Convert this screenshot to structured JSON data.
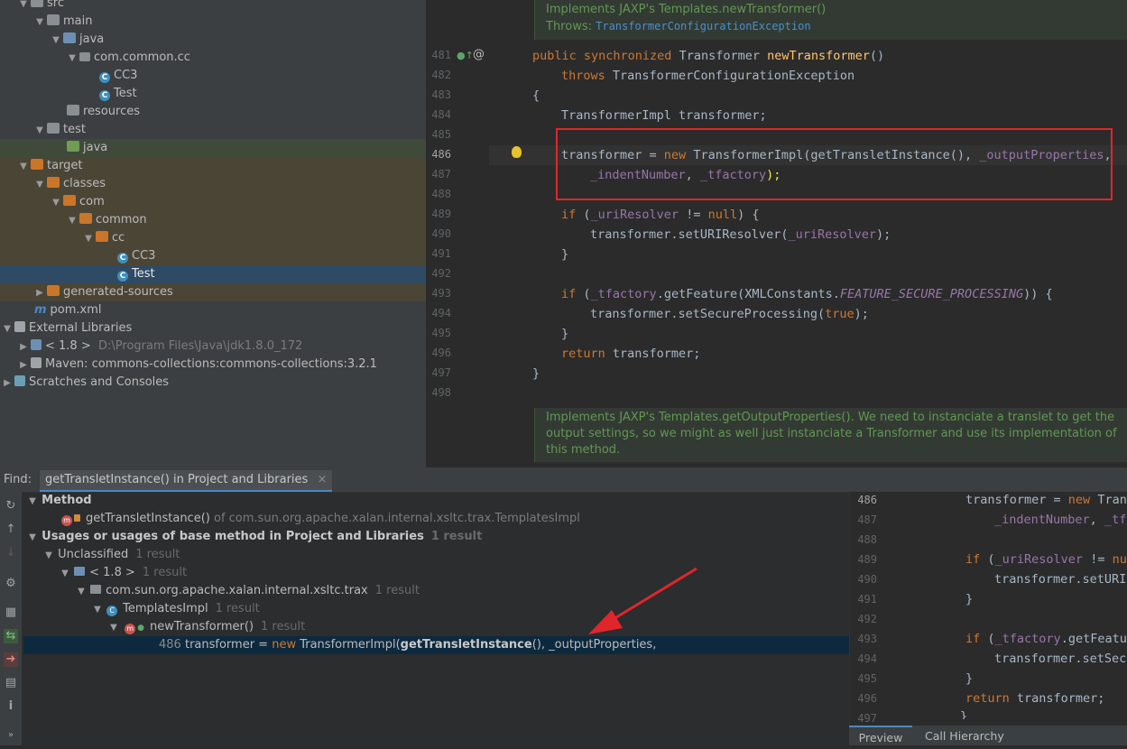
{
  "tree": {
    "src": "src",
    "main": "main",
    "java": "java",
    "pkg": "com.common.cc",
    "cc3": "CC3",
    "test_class": "Test",
    "resources": "resources",
    "test": "test",
    "test_java": "java",
    "target": "target",
    "classes": "classes",
    "com": "com",
    "common": "common",
    "cc": "cc",
    "cc3_class": "CC3",
    "test_class2": "Test",
    "generated": "generated-sources",
    "pom": "pom.xml",
    "ext_libs": "External Libraries",
    "jdk": "< 1.8 >",
    "jdk_path": "D:\\Program Files\\Java\\jdk1.8.0_172",
    "maven": "Maven: commons-collections:commons-collections:3.2.1",
    "scratches": "Scratches and Consoles"
  },
  "editor": {
    "doc1_line1": "Implements JAXP's Templates.newTransformer()",
    "doc1_throws": "Throws:",
    "doc1_link": "TransformerConfigurationException",
    "doc2": "Implements JAXP's Templates.getOutputProperties(). We need to instanciate a translet to get the output settings, so we might as well just instanciate a Transformer and use its implementation of this method.",
    "line_numbers": [
      "481",
      "482",
      "483",
      "484",
      "485",
      "486",
      "487",
      "488",
      "489",
      "490",
      "491",
      "492",
      "493",
      "494",
      "495",
      "496",
      "497",
      "498"
    ],
    "l481_kw": "public synchronized ",
    "l481_type": "Transformer ",
    "l481_fn": "newTransformer",
    "l481_end": "()",
    "l482_kw": "throws ",
    "l482_rest": "TransformerConfigurationException",
    "l483": "{",
    "l484": "TransformerImpl transformer;",
    "l486_a": "transformer = ",
    "l486_new": "new ",
    "l486_b": "TransformerImpl(getTransletInstance(), ",
    "l486_fld": "_outputProperties",
    "l486_c": ",",
    "l487_fld1": "_indentNumber",
    "l487_sep": ", ",
    "l487_fld2": "_tfactory",
    "l487_end": ");",
    "l489_kw": "if ",
    "l489_a": "(",
    "l489_fld": "_uriResolver",
    "l489_b": " != ",
    "l489_null": "null",
    "l489_c": ") {",
    "l490_a": "transformer.setURIResolver(",
    "l490_fld": "_uriResolver",
    "l490_b": ");",
    "l491": "}",
    "l493_kw": "if ",
    "l493_a": "(",
    "l493_fld": "_tfactory",
    "l493_b": ".getFeature(XMLConstants.",
    "l493_const": "FEATURE_SECURE_PROCESSING",
    "l493_c": ")) {",
    "l494_a": "transformer.setSecureProcessing(",
    "l494_true": "true",
    "l494_b": ");",
    "l495": "}",
    "l496_kw": "return ",
    "l496_rest": "transformer;",
    "l497": "}"
  },
  "find": {
    "label": "Find:",
    "tab": "getTransletInstance() in Project and Libraries",
    "tab_close": "×",
    "method_header": "Method",
    "method_name": "getTransletInstance()",
    "method_of": "of com.sun.org.apache.xalan.internal.xsltc.trax.TemplatesImpl",
    "usages_header": "Usages or usages of base method in Project and Libraries",
    "usages_count": "1 result",
    "unclassified": "Unclassified",
    "unclassified_count": "1 result",
    "jdk": "< 1.8 >",
    "jdk_count": "1 result",
    "package": "com.sun.org.apache.xalan.internal.xsltc.trax",
    "package_count": "1 result",
    "class": "TemplatesImpl",
    "class_count": "1 result",
    "method": "newTransformer()",
    "method_count": "1 result",
    "usage_line": "486",
    "usage_a": "transformer = ",
    "usage_new": "new ",
    "usage_b": "TransformerImpl(",
    "usage_bold": "getTransletInstance",
    "usage_c": "(), _outputProperties,"
  },
  "preview": {
    "line_numbers": [
      "486",
      "487",
      "488",
      "489",
      "490",
      "491",
      "492",
      "493",
      "494",
      "495",
      "496",
      "497"
    ],
    "p486_a": "transformer = ",
    "p486_new": "new ",
    "p486_b": "Trans",
    "p487_fld": "_indentNumber",
    "p487_sep": ", ",
    "p487_fld2": "_tfa",
    "p489_kw": "if ",
    "p489_a": "(",
    "p489_fld": "_uriResolver",
    "p489_b": " != ",
    "p489_null": "nul",
    "p490": "transformer.setURIR",
    "p491": "}",
    "p493_kw": "if ",
    "p493_a": "(",
    "p493_fld": "_tfactory",
    "p493_b": ".getFeatur",
    "p494": "transformer.setSecu",
    "p495": "}",
    "p496_kw": "return ",
    "p496_rest": "transformer;",
    "p497": "}",
    "tab_preview": "Preview",
    "tab_hierarchy": "Call Hierarchy"
  },
  "colors": {
    "annotation_red": "#e0262b",
    "keyword": "#cc7832",
    "field": "#9876aa",
    "function": "#ffc66d"
  }
}
